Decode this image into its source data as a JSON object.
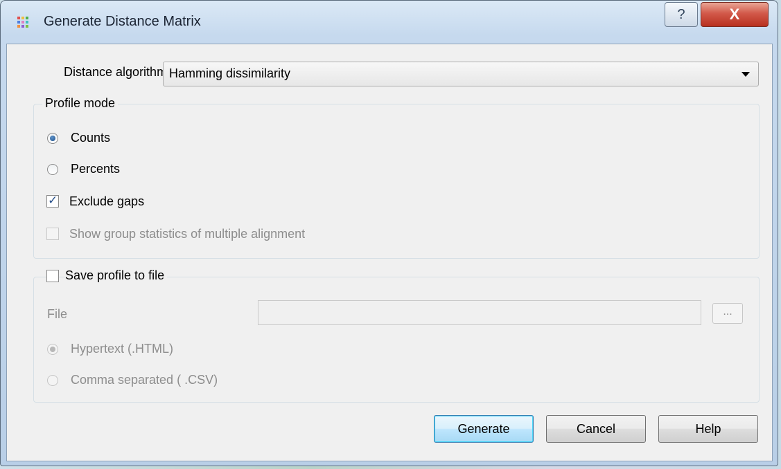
{
  "window": {
    "title": "Generate Distance Matrix",
    "help_label": "?",
    "close_label": "X"
  },
  "algorithm": {
    "label": "Distance algorithm",
    "value": "Hamming dissimilarity"
  },
  "profile_mode": {
    "title": "Profile mode",
    "counts": "Counts",
    "percents": "Percents",
    "exclude_gaps": "Exclude gaps",
    "group_stats": "Show group statistics of multiple alignment"
  },
  "save_profile": {
    "title": "Save profile to file",
    "file_label": "File",
    "file_value": "",
    "browse_label": "...",
    "html_option": "Hypertext  (.HTML)",
    "csv_option": "Comma separated ( .CSV)"
  },
  "buttons": {
    "generate": "Generate",
    "cancel": "Cancel",
    "help": "Help"
  },
  "state": {
    "selected_mode": "Counts",
    "exclude_gaps_checked": true,
    "group_stats_checked": false,
    "save_profile_checked": false,
    "selected_format": "Hypertext  (.HTML)"
  }
}
